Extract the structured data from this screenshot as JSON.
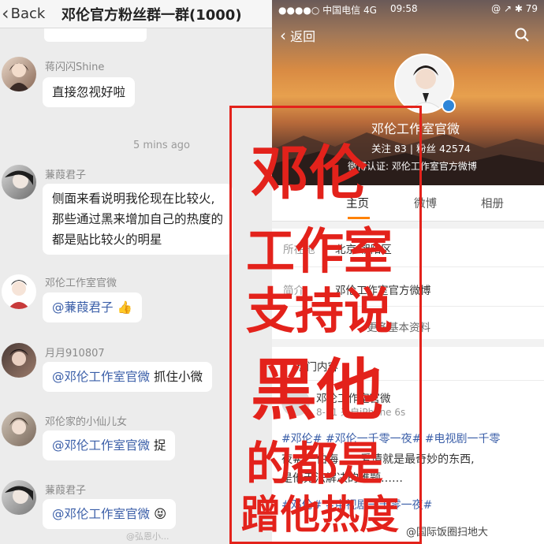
{
  "chat": {
    "back_label": "Back",
    "title": "邓伦官方粉丝群一群(1000)",
    "messages": [
      {
        "user": "蒋闪闪Shine",
        "text": "直接忽视好啦"
      },
      {
        "time": "5 mins ago"
      },
      {
        "user": "蒹葭君子",
        "lines": [
          "侧面来看说明我伦现在比较火,",
          "那些通过黑来增加自己的热度的",
          "都是贴比较火的明星"
        ]
      },
      {
        "user": "邓伦工作室官微",
        "mention": "@蒹葭君子",
        "emoji": "👍"
      },
      {
        "user": "月月910807",
        "mention": "@邓伦工作室官微",
        "text": " 抓住小微"
      },
      {
        "user": "邓伦家的小仙儿女",
        "mention": "@邓伦工作室官微",
        "text": " 捉"
      },
      {
        "user": "蒹葭君子",
        "mention": "@邓伦工作室官微",
        "emoji": "😝"
      }
    ],
    "watermark": "@弘恩小..."
  },
  "profile": {
    "status_bar": {
      "carrier": "●●●●○ 中国电信  4G",
      "time": "09:58",
      "battery": "@ ↗ ✱ 79"
    },
    "back_label": "返回",
    "name": "邓伦工作室官微",
    "stats": "关注  83  |  粉丝  42574",
    "intro": "微博认证: 邓伦工作室官方微博",
    "tabs": [
      "主页",
      "微博",
      "相册"
    ],
    "info_rows": [
      {
        "label": "所在地",
        "value": "北京 朝阳区"
      },
      {
        "label": "简介",
        "value": "邓伦工作室官方微博"
      }
    ],
    "more_info": "更多基本资料",
    "hot_section_title": "热门内容",
    "post": {
      "author": "邓伦工作室官微",
      "meta": "8-11  来自iPhone 6s",
      "tags_line": "#邓伦# #邓伦一千零一夜# #电视剧一千零",
      "body_line1": "夜# 一伯海……爱情就是最奇妙的东西,",
      "body_line2": "是他无法解决的难题……",
      "tags_line2": "#邓伦# #电视剧一千零一夜#"
    },
    "watermark": "@国际饭圈扫地大"
  },
  "overlay": {
    "lines": [
      "邓伦",
      "工作室",
      "支持说",
      "黑他",
      "的都是",
      "蹭他热度"
    ],
    "color": "#e3221b"
  }
}
